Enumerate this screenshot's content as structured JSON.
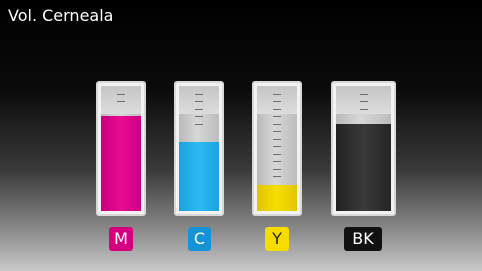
{
  "title": "Vol. Cerneala",
  "ink": [
    {
      "label": "M",
      "level": 0.76,
      "color": "#e6008e",
      "label_bg": "#d4007f",
      "label_fg": "#ffffff",
      "ticks": [
        0.06,
        0.12
      ]
    },
    {
      "label": "C",
      "level": 0.55,
      "color": "#22b1ec",
      "label_bg": "#1593d6",
      "label_fg": "#ffffff",
      "ticks": [
        0.06,
        0.12,
        0.18,
        0.24,
        0.3
      ]
    },
    {
      "label": "Y",
      "level": 0.21,
      "color": "#f2d600",
      "label_bg": "#f6dc00",
      "label_fg": "#222222",
      "ticks": [
        0.06,
        0.12,
        0.18,
        0.24,
        0.3,
        0.36,
        0.42,
        0.48,
        0.54,
        0.6,
        0.66,
        0.72
      ]
    },
    {
      "label": "BK",
      "level": 0.7,
      "color": "#2c2c2c",
      "label_bg": "#111111",
      "label_fg": "#ffffff",
      "ticks": [
        0.06,
        0.12,
        0.18
      ]
    }
  ]
}
